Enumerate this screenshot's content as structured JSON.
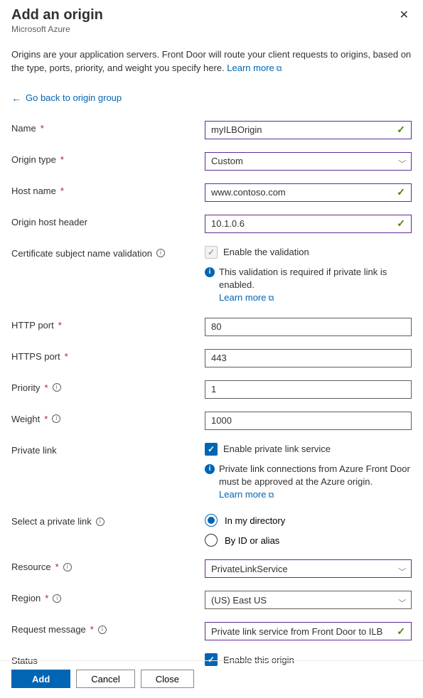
{
  "header": {
    "title": "Add an origin",
    "subtitle": "Microsoft Azure"
  },
  "description": "Origins are your application servers. Front Door will route your client requests to origins, based on the type, ports, priority, and weight you specify here.",
  "learn_more": "Learn more",
  "back_link": "Go back to origin group",
  "labels": {
    "name": "Name",
    "origin_type": "Origin type",
    "host_name": "Host name",
    "origin_host_header": "Origin host header",
    "cert_validation": "Certificate subject name validation",
    "http_port": "HTTP port",
    "https_port": "HTTPS port",
    "priority": "Priority",
    "weight": "Weight",
    "private_link": "Private link",
    "select_private_link": "Select a private link",
    "resource": "Resource",
    "region": "Region",
    "request_message": "Request message",
    "status": "Status"
  },
  "values": {
    "name": "myILBOrigin",
    "origin_type": "Custom",
    "host_name": "www.contoso.com",
    "origin_host_header": "10.1.0.6",
    "http_port": "80",
    "https_port": "443",
    "priority": "1",
    "weight": "1000",
    "resource": "PrivateLinkService",
    "region": "(US) East US",
    "request_message": "Private link service from Front Door to ILB"
  },
  "checkboxes": {
    "enable_validation": "Enable the validation",
    "enable_private_link": "Enable private link service",
    "enable_origin": "Enable this origin"
  },
  "info": {
    "validation": "This validation is required if private link is enabled.",
    "private_link": "Private link connections from Azure Front Door must be approved at the Azure origin."
  },
  "radio": {
    "in_directory": "In my directory",
    "by_id": "By ID or alias"
  },
  "footer": {
    "add": "Add",
    "cancel": "Cancel",
    "close": "Close"
  }
}
